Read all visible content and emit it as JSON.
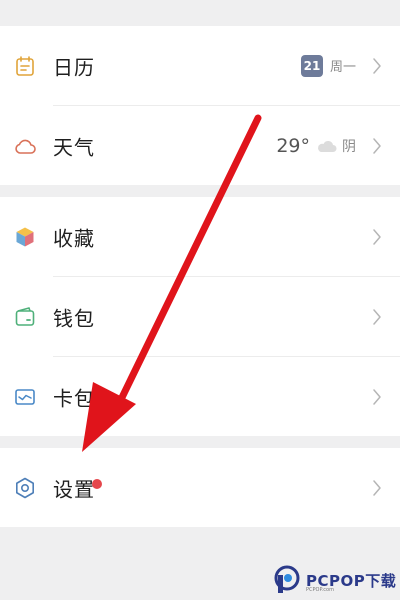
{
  "menu": {
    "calendar": {
      "label": "日历",
      "date": "21",
      "weekday": "周一"
    },
    "weather": {
      "label": "天气",
      "temperature": "29°",
      "condition": "阴"
    },
    "favorites": {
      "label": "收藏"
    },
    "wallet": {
      "label": "钱包"
    },
    "cards": {
      "label": "卡包"
    },
    "settings": {
      "label": "设置"
    }
  },
  "watermark": {
    "brand": "PCPOP下载",
    "sub": "PCPOP.com"
  },
  "colors": {
    "calendar_icon": "#e0a43a",
    "weather_icon": "#d97158",
    "favorites_icon": "#6aa7d6",
    "wallet_icon": "#4fb07a",
    "cards_icon": "#4a89c7",
    "settings_icon": "#4e7fb8",
    "notification_dot": "#e5464b",
    "annotation_arrow": "#e0141b"
  },
  "icons": [
    "calendar-icon",
    "cloud-icon",
    "cube-icon",
    "wallet-icon",
    "card-icon",
    "gear-icon",
    "chevron-right-icon"
  ]
}
